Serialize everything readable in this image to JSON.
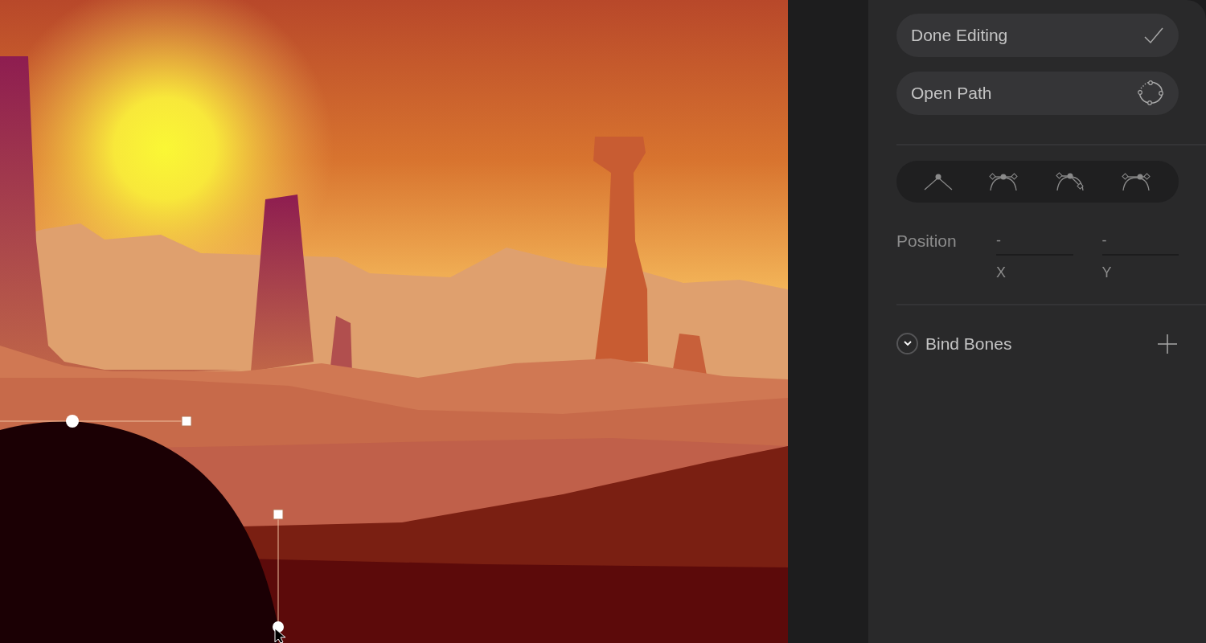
{
  "panel": {
    "buttons": [
      {
        "label": "Done Editing",
        "kind": "check"
      },
      {
        "label": "Open Path",
        "kind": "path"
      }
    ],
    "vertex_modes": [
      {
        "kind": "corner"
      },
      {
        "kind": "mirrored"
      },
      {
        "kind": "detached"
      },
      {
        "kind": "asymmetric"
      }
    ],
    "position": {
      "label": "Position",
      "fields": [
        {
          "value": "-",
          "axis": "X"
        },
        {
          "value": "-",
          "axis": "Y"
        }
      ]
    },
    "bind_bones": {
      "label": "Bind Bones"
    }
  }
}
